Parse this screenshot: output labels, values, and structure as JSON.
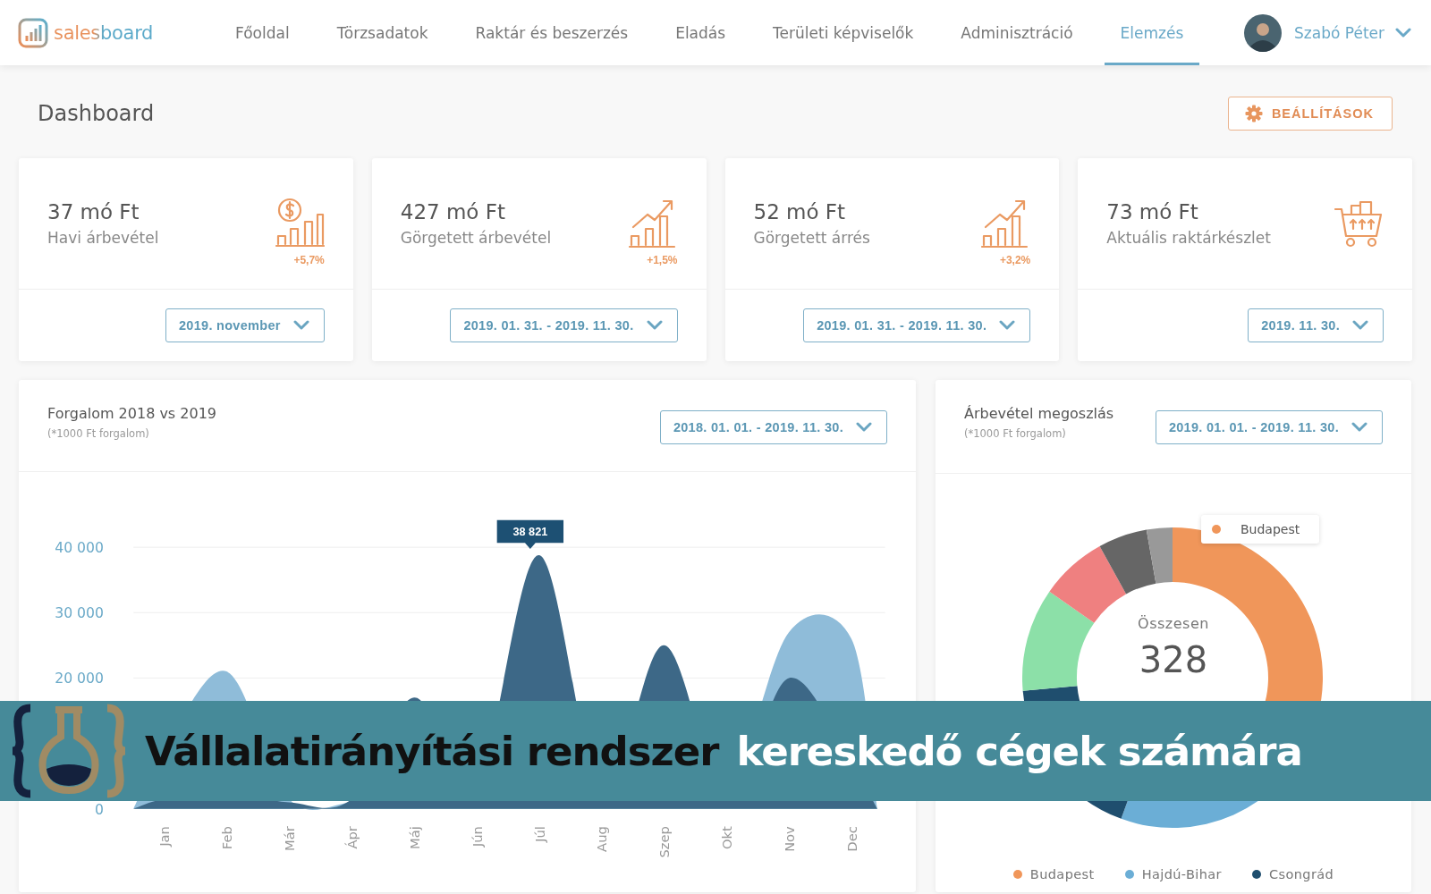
{
  "brand": {
    "name": "salesboard"
  },
  "nav": [
    {
      "label": "Főoldal",
      "selected": false
    },
    {
      "label": "Törzsadatok",
      "selected": false
    },
    {
      "label": "Raktár és beszerzés",
      "selected": false
    },
    {
      "label": "Eladás",
      "selected": false
    },
    {
      "label": "Területi képviselők",
      "selected": false
    },
    {
      "label": "Adminisztráció",
      "selected": false
    },
    {
      "label": "Elemzés",
      "selected": true
    }
  ],
  "user": {
    "name": "Szabó Péter"
  },
  "page": {
    "title": "Dashboard",
    "settings_button": "BEÁLLÍTÁSOK"
  },
  "stats": [
    {
      "value": "37 mó Ft",
      "label": "Havi árbevétel",
      "kind": "revenue",
      "delta": "+5,7%",
      "period": "2019. november"
    },
    {
      "value": "427 mó Ft",
      "label": "Görgetett árbevétel",
      "kind": "trend",
      "delta": "+1,5%",
      "period": "2019. 01. 31. - 2019. 11. 30."
    },
    {
      "value": "52 mó Ft",
      "label": "Görgetett árrés",
      "kind": "trend",
      "delta": "+3,2%",
      "period": "2019. 01. 31. - 2019. 11. 30."
    },
    {
      "value": "73 mó Ft",
      "label": "Aktuális raktárkészlet",
      "kind": "cart",
      "period": "2019. 11. 30."
    }
  ],
  "traffic": {
    "title": "Forgalom 2018 vs 2019",
    "subtitle": "(*1000 Ft forgalom)",
    "period": "2018. 01. 01. - 2019. 11. 30.",
    "y_axis_labels": [
      "40 000",
      "30 000",
      "20 000",
      "0"
    ],
    "x_axis_labels": [
      "Jan",
      "Feb",
      "Már",
      "Ápr",
      "Máj",
      "Jún",
      "Júl",
      "Aug",
      "Szep",
      "Okt",
      "Nov",
      "Dec"
    ],
    "tooltip": "38 821"
  },
  "distribution": {
    "title": "Árbevétel megoszlás",
    "subtitle": "(*1000 Ft forgalom)",
    "period": "2019. 01. 01. - 2019. 11. 30.",
    "total_label": "Összesen",
    "total": "328",
    "tooltip": "Budapest",
    "legend": [
      {
        "label": "Budapest",
        "color": "#f0965a"
      },
      {
        "label": "Hajdú-Bihar",
        "color": "#6baed6"
      },
      {
        "label": "Csongrád",
        "color": "#1f4e6e"
      }
    ]
  },
  "banner": {
    "title_dark": "Vállalatirányítási rendszer",
    "title_light": "kereskedő cégek számára"
  }
}
